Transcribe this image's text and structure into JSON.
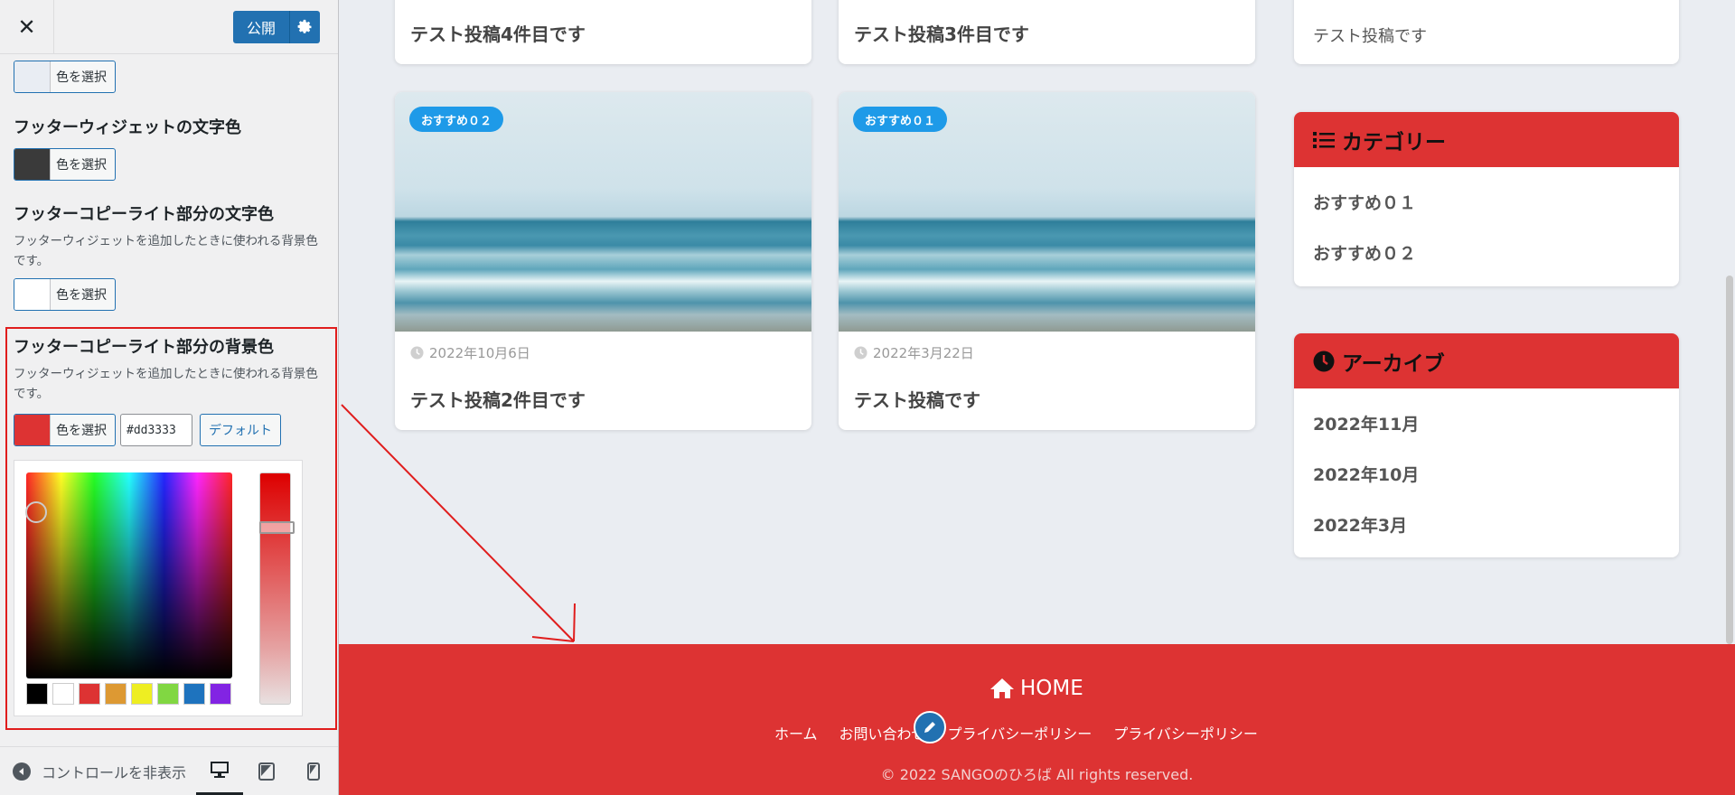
{
  "customizer": {
    "close_label": "✕",
    "publish_label": "公開",
    "controls": [
      {
        "swatch_color": "#e9edf3",
        "button_label": "色を選択"
      },
      {
        "title": "フッターウィジェットの文字色",
        "swatch_color": "#3a3a3a",
        "button_label": "色を選択"
      },
      {
        "title": "フッターコピーライト部分の文字色",
        "description": "フッターウィジェットを追加したときに使われる背景色です。",
        "swatch_color": "#ffffff",
        "button_label": "色を選択"
      },
      {
        "title": "フッターコピーライト部分の背景色",
        "description": "フッターウィジェットを追加したときに使われる背景色です。",
        "swatch_color": "#dd3333",
        "button_label": "色を選択",
        "hex_value": "#dd3333",
        "default_label": "デフォルト"
      }
    ],
    "palette_colors": [
      "#000000",
      "#ffffff",
      "#dd3333",
      "#dd9933",
      "#eeee22",
      "#81d742",
      "#1e73be",
      "#8224e3"
    ],
    "footer": {
      "collapse_label": "コントロールを非表示"
    }
  },
  "preview": {
    "cards": [
      {
        "title": "テスト投稿4件目です"
      },
      {
        "title": "テスト投稿3件目です"
      },
      {
        "badge": "おすすめ０２",
        "date": "2022年10月6日",
        "title": "テスト投稿2件目です"
      },
      {
        "badge": "おすすめ０１",
        "date": "2022年3月22日",
        "title": "テスト投稿です"
      }
    ],
    "top_widget_item": "テスト投稿です",
    "category_widget": {
      "title": "カテゴリー",
      "items": [
        "おすすめ０１",
        "おすすめ０２"
      ]
    },
    "archive_widget": {
      "title": "アーカイブ",
      "items": [
        "2022年11月",
        "2022年10月",
        "2022年3月"
      ]
    },
    "footer": {
      "home_label": "HOME",
      "nav": [
        "ホーム",
        "お問い合わせ",
        "プライバシーポリシー",
        "プライバシーポリシー"
      ],
      "copyright": "© 2022 SANGOのひろば All rights reserved.",
      "background_color": "#dd3333"
    }
  }
}
